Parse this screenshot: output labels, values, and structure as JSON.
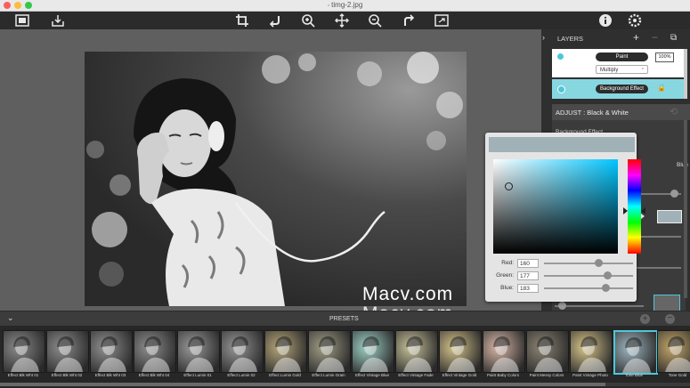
{
  "window": {
    "title": "timg-2.jpg"
  },
  "toolbar": {
    "left_icons": [
      "image-frame-icon",
      "save-tray-icon"
    ],
    "center_icons": [
      "crop-icon",
      "rotate-left-icon",
      "zoom-in-icon",
      "move-icon",
      "zoom-out-icon",
      "rotate-right-icon",
      "fit-screen-icon"
    ],
    "right_icons": [
      "info-icon",
      "settings-icon"
    ]
  },
  "layers": {
    "title": "LAYERS",
    "add": "+",
    "remove": "−",
    "duplicate": "⧉",
    "paint": {
      "name": "Paint",
      "opacity": "100%",
      "blend": "Multiply"
    },
    "background": {
      "name": "Background Effect"
    }
  },
  "adjust": {
    "title": "ADJUST : Black & White",
    "subtitle": "Background Effect",
    "partial_label": "Blue"
  },
  "color_picker": {
    "red_label": "Red:",
    "red": "160",
    "green_label": "Green:",
    "green": "177",
    "blue_label": "Blue:",
    "blue": "183",
    "swatch_color": "#a0b1b7"
  },
  "presets": {
    "title": "PRESETS",
    "items": [
      {
        "label": "Effect Blk Wht 01"
      },
      {
        "label": "Effect Blk Wht 02"
      },
      {
        "label": "Effect Blk Wht 03"
      },
      {
        "label": "Effect Blk Wht 04"
      },
      {
        "label": "Effect Lumin 01"
      },
      {
        "label": "Effect Lumin 02"
      },
      {
        "label": "Effect Lumin Gold"
      },
      {
        "label": "Effect Lumin Grain"
      },
      {
        "label": "Effect Vintage Blue"
      },
      {
        "label": "Effect Vintage Fade"
      },
      {
        "label": "Effect Vintage Gold"
      },
      {
        "label": "Paint Baby Colors"
      },
      {
        "label": "Paint Messy Colors"
      },
      {
        "label": "Paint Vintage Photo"
      },
      {
        "label": "Tone Blue"
      },
      {
        "label": "Tone Gold"
      }
    ]
  },
  "watermark": {
    "text1": "Macv.com",
    "text2": "Macv.com"
  },
  "colors": {
    "accent": "#4fc6d8",
    "panel": "#2f2f2f",
    "toolbar": "#2b2b2b"
  }
}
